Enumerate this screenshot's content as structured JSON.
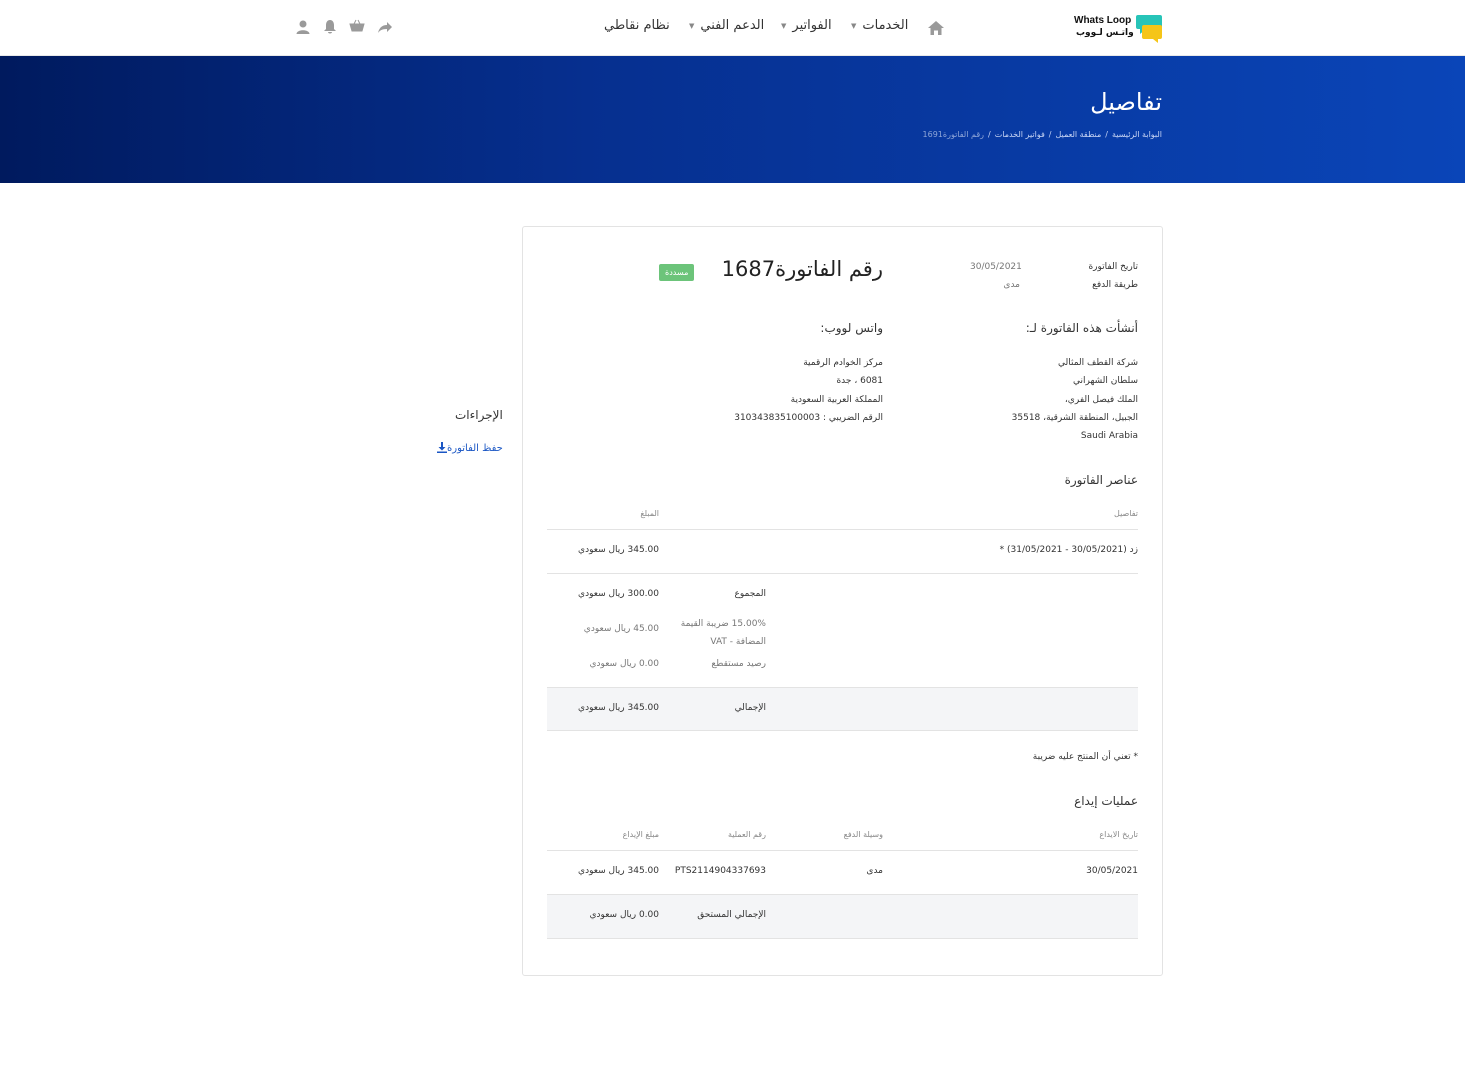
{
  "brand": {
    "name_en": "Whats Loop",
    "name_ar": "واتـس لـووب",
    "color_primary": "#27c4b8",
    "color_secondary": "#f5c518"
  },
  "nav": {
    "items": [
      {
        "label": "الخدمات"
      },
      {
        "label": "الفواتير"
      },
      {
        "label": "الدعم الفني"
      },
      {
        "label": "نظام نقاطي"
      }
    ]
  },
  "banner": {
    "title": "تفاصيل",
    "breadcrumb": [
      "البوابة الرئيسية",
      "منطقة العميل",
      "فواتير الخدمات",
      "رقم الفاتورة1691"
    ],
    "separator": "/"
  },
  "actions": {
    "title": "الإجراءات",
    "download_label": "حفظ الفاتورة"
  },
  "invoice": {
    "title": "رقم الفاتورة1687",
    "status": "مسددة",
    "date_label": "تاريخ الفاتورة",
    "date_value": "30/05/2021",
    "method_label": "طريقة الدفع",
    "method_value": "مدى",
    "issued_for_title": "أنشأت هذه الفاتورة لـ:",
    "issued_for": [
      "شركة القطف المثالي",
      "سلطان الشهراني",
      "الملك فيصل الفري،",
      "الجبيل، المنطقة الشرقية، 35518",
      "Saudi Arabia"
    ],
    "issuer_title": "واتس لووب:",
    "issuer": [
      "مركز الخوادم الرقمية",
      "6081 ، جدة",
      "المملكة العربية السعودية",
      "الرقم الضريبي : 310343835100003"
    ],
    "items_title": "عناصر الفاتورة",
    "items_headers": {
      "details": "تفاصيل",
      "amount": "المبلغ"
    },
    "items": [
      {
        "details": "زد (30/05/2021 - 31/05/2021) *",
        "amount": "345.00 ريال سعودي"
      }
    ],
    "subtotal_label": "المجموع",
    "subtotal_value": "300.00 ريال سعودي",
    "vat_label_1": "15.00% ضريبة القيمة",
    "vat_label_2": "المضافة - VAT",
    "vat_value": "45.00 ريال سعودي",
    "credit_label": "رصيد مستقطع",
    "credit_value": "0.00 ريال سعودي",
    "total_label": "الإجمالي",
    "total_value": "345.00 ريال سعودي",
    "tax_note": "* تعني أن المنتج عليه ضريبة",
    "deposits_title": "عمليات إيداع",
    "deposits_headers": {
      "date": "تاريخ الايداع",
      "method": "وسيلة الدفع",
      "txn": "رقم العملية",
      "amount": "مبلغ الإيداع"
    },
    "deposits": [
      {
        "date": "30/05/2021",
        "method": "مدى",
        "txn": "PTS2114904337693",
        "amount": "345.00 ريال سعودي"
      }
    ],
    "due_label": "الإجمالي المستحق",
    "due_value": "0.00 ريال سعودي"
  }
}
